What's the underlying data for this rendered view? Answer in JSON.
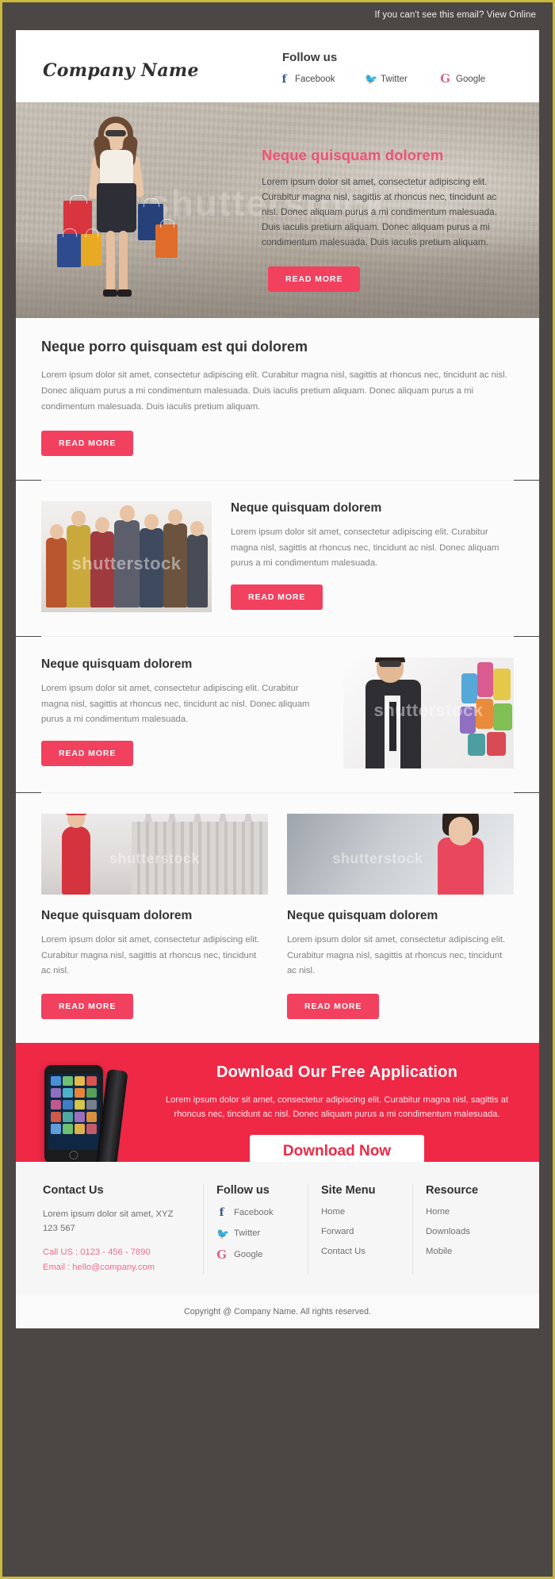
{
  "preheader": {
    "text": "If you can't see this email? View Online"
  },
  "masthead": {
    "brand": "Company Name",
    "follow_title": "Follow us",
    "social": [
      {
        "label": "Facebook",
        "glyph": "f",
        "icon": "facebook-icon"
      },
      {
        "label": "Twitter",
        "glyph": "ᴠ",
        "icon": "twitter-icon"
      },
      {
        "label": "Google",
        "glyph": "G",
        "icon": "google-plus-icon"
      }
    ]
  },
  "hero": {
    "title": "Neque quisquam dolorem",
    "text": "Lorem ipsum dolor sit amet, consectetur adipiscing elit. Curabitur magna nisl, sagittis at rhoncus nec, tincidunt ac nisl. Donec aliquam purus a mi condimentum malesuada. Duis iaculis pretium aliquam. Donec aliquam purus a mi condimentum malesuada. Duis iaculis pretium aliquam.",
    "button": "READ MORE",
    "watermark": "shutterstock"
  },
  "intro": {
    "title": "Neque porro quisquam est qui dolorem",
    "text": "Lorem ipsum dolor sit amet, consectetur adipiscing elit. Curabitur magna nisl, sagittis at rhoncus nec, tincidunt ac nisl. Donec aliquam purus a mi condimentum malesuada. Duis iaculis pretium aliquam. Donec aliquam purus a mi condimentum malesuada. Duis iaculis pretium aliquam.",
    "button": "READ MORE"
  },
  "feature_left_image": {
    "title": "Neque quisquam dolorem",
    "text": "Lorem ipsum dolor sit amet, consectetur adipiscing elit. Curabitur magna nisl, sagittis at rhoncus nec, tincidunt ac nisl. Donec aliquam purus a mi condimentum malesuada.",
    "button": "READ MORE",
    "watermark": "shutterstock"
  },
  "feature_right_image": {
    "title": "Neque quisquam dolorem",
    "text": "Lorem ipsum dolor sit amet, consectetur adipiscing elit. Curabitur magna nisl, sagittis at rhoncus nec, tincidunt ac nisl. Donec aliquam purus a mi condimentum malesuada.",
    "button": "READ MORE",
    "watermark": "shutterstock"
  },
  "cards": [
    {
      "title": "Neque quisquam dolorem",
      "text": "Lorem ipsum dolor sit amet, consectetur adipiscing elit. Curabitur magna nisl, sagittis at rhoncus nec, tincidunt ac nisl.",
      "button": "READ MORE",
      "watermark": "shutterstock"
    },
    {
      "title": "Neque quisquam dolorem",
      "text": "Lorem ipsum dolor sit amet, consectetur adipiscing elit. Curabitur magna nisl, sagittis at rhoncus nec, tincidunt ac nisl.",
      "button": "READ MORE",
      "watermark": "shutterstock"
    }
  ],
  "download": {
    "title": "Download Our Free Application",
    "text": "Lorem ipsum dolor sit amet, consectetur adipiscing elit. Curabitur magna nisl, sagittis at rhoncus nec, tincidunt ac nisl. Donec aliquam purus a mi condimentum malesuada.",
    "button": "Download Now"
  },
  "footer": {
    "contact": {
      "title": "Contact Us",
      "address": "Lorem ipsum dolor sit amet, XYZ 123 567",
      "phone": "Call US : 0123 - 456 - 7890",
      "email": "Email : hello@company.com"
    },
    "follow": {
      "title": "Follow us",
      "items": [
        {
          "label": "Facebook",
          "glyph": "f",
          "icon": "facebook-icon"
        },
        {
          "label": "Twitter",
          "glyph": "ᴠ",
          "icon": "twitter-icon"
        },
        {
          "label": "Google",
          "glyph": "G",
          "icon": "google-plus-icon"
        }
      ]
    },
    "site_menu": {
      "title": "Site Menu",
      "items": [
        "Home",
        "Forward",
        "Contact Us"
      ]
    },
    "resource": {
      "title": "Resource",
      "items": [
        "Home",
        "Downloads",
        "Mobile"
      ]
    },
    "copyright": "Copyright @ Company Name. All rights reserved."
  },
  "colors": {
    "accent": "#f2415f",
    "banner": "#ef2846",
    "hero_title": "#ef5274",
    "dark_bar": "#4a4745",
    "page_border": "#ccb93f",
    "footer_pink": "#ef6d88"
  }
}
